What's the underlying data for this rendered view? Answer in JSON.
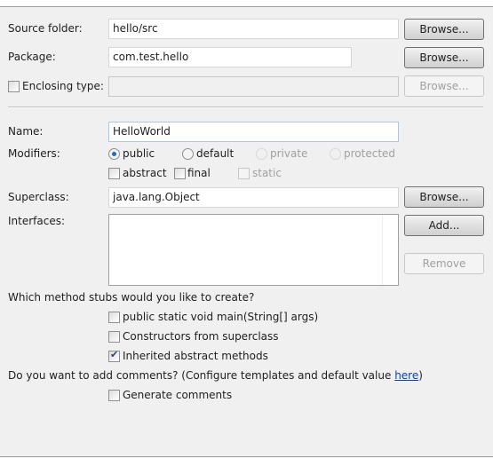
{
  "source_folder": {
    "label": "Source folder:",
    "value": "hello/src",
    "browse": "Browse..."
  },
  "package": {
    "label": "Package:",
    "value": "com.test.hello",
    "browse": "Browse..."
  },
  "enclosing_type": {
    "label": "Enclosing type:",
    "value": "",
    "browse": "Browse...",
    "checked": false
  },
  "name": {
    "label": "Name:",
    "value": "HelloWorld"
  },
  "modifiers": {
    "label": "Modifiers:",
    "radios": [
      "public",
      "default",
      "private",
      "protected"
    ],
    "selected": "public",
    "checks": [
      "abstract",
      "final",
      "static"
    ]
  },
  "superclass": {
    "label": "Superclass:",
    "value": "java.lang.Object",
    "browse": "Browse..."
  },
  "interfaces": {
    "label": "Interfaces:",
    "add": "Add...",
    "remove": "Remove"
  },
  "stubs": {
    "question": "Which method stubs would you like to create?",
    "options": [
      {
        "label": "public static void main(String[] args)",
        "checked": false
      },
      {
        "label": "Constructors from superclass",
        "checked": false
      },
      {
        "label": "Inherited abstract methods",
        "checked": true
      }
    ]
  },
  "comments": {
    "question": "Do you want to add comments? (Configure templates and default value ",
    "link": "here",
    "close": ")",
    "option": "Generate comments",
    "checked": false
  }
}
